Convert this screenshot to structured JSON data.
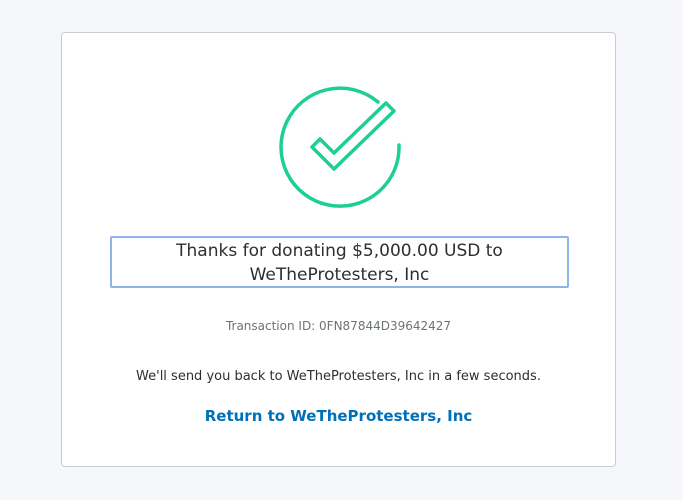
{
  "confirmation": {
    "icon": "checkmark-circle-icon",
    "accent_color": "#1ed08f",
    "headline_line1": "Thanks for donating $5,000.00 USD to",
    "headline_line2": "WeTheProtesters, Inc",
    "transaction_label": "Transaction ID: 0FN87844D39642427",
    "redirect_message": "We'll send you back to WeTheProtesters, Inc in a few seconds.",
    "return_link_label": "Return to WeTheProtesters, Inc"
  }
}
